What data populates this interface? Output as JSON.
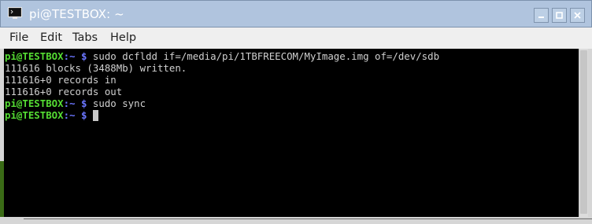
{
  "window": {
    "title": "pi@TESTBOX: ~",
    "icon": "terminal-icon",
    "controls": {
      "minimize_icon": "minimize-icon",
      "maximize_icon": "maximize-icon",
      "close_icon": "close-icon"
    }
  },
  "menu": {
    "items": [
      {
        "label": "File"
      },
      {
        "label": "Edit"
      },
      {
        "label": "Tabs"
      },
      {
        "label": "Help"
      }
    ]
  },
  "terminal": {
    "lines": [
      {
        "kind": "prompt",
        "user": "pi@TESTBOX",
        "sep": ":",
        "path": "~ $",
        "cmd": " sudo dcfldd if=/media/pi/1TBFREECOM/MyImage.img of=/dev/sdb"
      },
      {
        "kind": "output",
        "text": "111616 blocks (3488Mb) written."
      },
      {
        "kind": "output",
        "text": "111616+0 records in"
      },
      {
        "kind": "output",
        "text": "111616+0 records out"
      },
      {
        "kind": "prompt",
        "user": "pi@TESTBOX",
        "sep": ":",
        "path": "~ $",
        "cmd": " sudo sync"
      },
      {
        "kind": "prompt",
        "user": "pi@TESTBOX",
        "sep": ":",
        "path": "~ $",
        "cmd": " "
      }
    ]
  },
  "colors": {
    "titlebar": "#b0c4de",
    "terminal_bg": "#000000",
    "prompt_user": "#55dd33",
    "prompt_path": "#6b76ff",
    "text": "#d0d0d0"
  }
}
